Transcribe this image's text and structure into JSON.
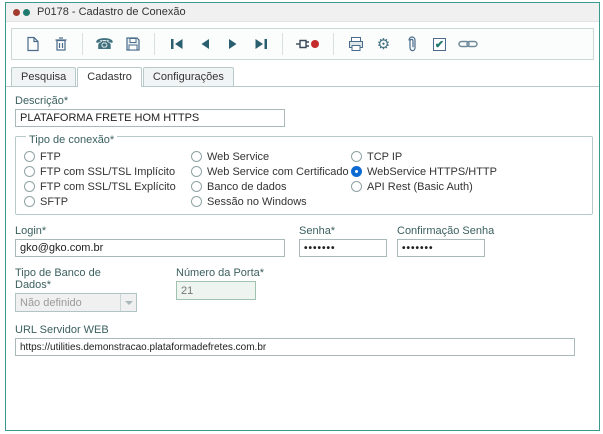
{
  "colors": {
    "window_border": "#3a9a8c",
    "accent_teal": "#20796d",
    "radio_selected_blue": "#0b6bd3",
    "titlebar_dot_red": "#a33a2e",
    "titlebar_dot_teal": "#20796d"
  },
  "window": {
    "title": "P0178 - Cadastro de Conexão"
  },
  "toolbar": {
    "icons": [
      "new-document",
      "delete",
      "phone",
      "save",
      "first-record",
      "previous-record",
      "next-record",
      "last-record",
      "connection-plug-red-dot",
      "print",
      "settings",
      "attachment",
      "confirm-checkbox",
      "link"
    ]
  },
  "tabs": [
    {
      "label": "Pesquisa",
      "active": false
    },
    {
      "label": "Cadastro",
      "active": true
    },
    {
      "label": "Configurações",
      "active": false
    }
  ],
  "form": {
    "descricao": {
      "label": "Descrição*",
      "value": "PLATAFORMA FRETE HOM HTTPS"
    },
    "tipo_conexao": {
      "legend": "Tipo de conexão*",
      "columns": [
        {
          "options": [
            {
              "label": "FTP",
              "selected": false
            },
            {
              "label": "FTP com SSL/TSL Implícito",
              "selected": false
            },
            {
              "label": "FTP com SSL/TSL Explícito",
              "selected": false
            },
            {
              "label": "SFTP",
              "selected": false
            }
          ]
        },
        {
          "options": [
            {
              "label": "Web Service",
              "selected": false
            },
            {
              "label": "Web Service com Certificado",
              "selected": false
            },
            {
              "label": "Banco de dados",
              "selected": false
            },
            {
              "label": "Sessão no Windows",
              "selected": false
            }
          ]
        },
        {
          "options": [
            {
              "label": "TCP IP",
              "selected": false
            },
            {
              "label": "WebService HTTPS/HTTP",
              "selected": true
            },
            {
              "label": "API Rest (Basic Auth)",
              "selected": false
            }
          ]
        }
      ]
    },
    "login": {
      "label": "Login*",
      "value": "gko@gko.com.br"
    },
    "senha": {
      "label": "Senha*",
      "value": "•••••••"
    },
    "confirmacao_senha": {
      "label": "Confirmação Senha",
      "value": "•••••••"
    },
    "tipo_banco": {
      "label": "Tipo de Banco de Dados*",
      "value": "Não definido"
    },
    "porta": {
      "label": "Número da Porta*",
      "value": "21"
    },
    "url": {
      "label": "URL Servidor WEB",
      "value": "https://utilities.demonstracao.plataformadefretes.com.br"
    }
  }
}
